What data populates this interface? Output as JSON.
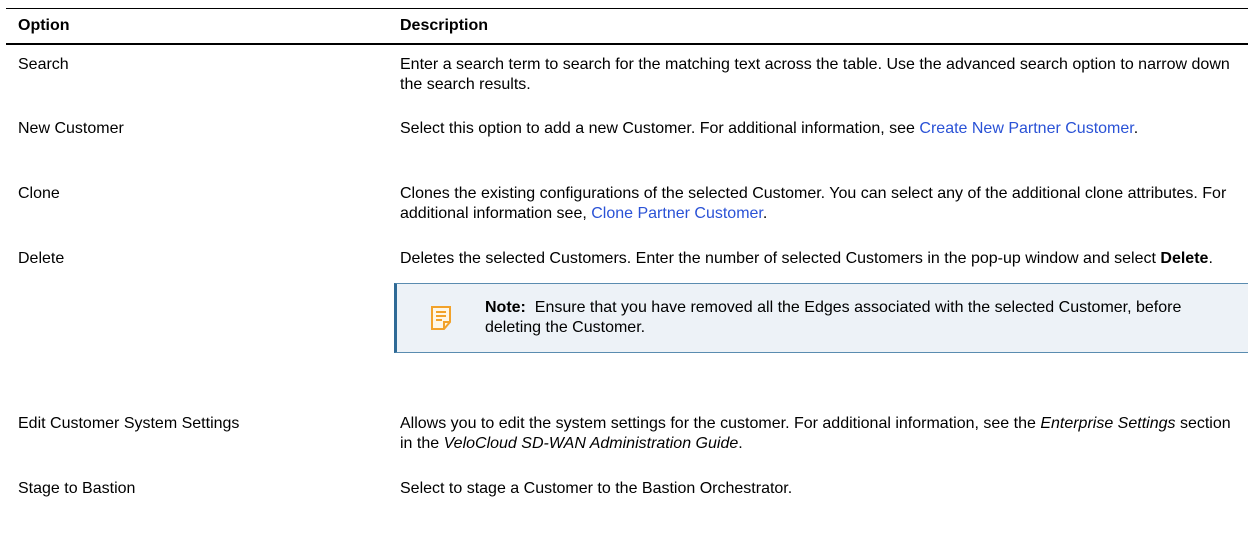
{
  "header": {
    "option": "Option",
    "description": "Description"
  },
  "rows": [
    {
      "option": "Search",
      "desc": "Enter a search term to search for the matching text across the table. Use the advanced search option to narrow down the search results."
    },
    {
      "option": "New Customer",
      "desc_before": "Select this option to add a new Customer. For additional information, see ",
      "link": "Create New Partner Customer",
      "desc_after": "."
    },
    {
      "option": "Clone",
      "desc_before": "Clones the existing configurations of the selected Customer. You can select any of the additional clone attributes. For additional information see, ",
      "link": "Clone Partner Customer",
      "desc_after": "."
    },
    {
      "option": "Delete",
      "desc_before": "Deletes the selected Customers. Enter the number of selected Customers in the pop-up window and select ",
      "bold": "Delete",
      "desc_after": ".",
      "note_label": "Note:",
      "note_text": "Ensure that you have removed all the Edges associated with the selected Customer, before deleting the Customer.",
      "note_icon": "note-icon",
      "note_icon_color": "#f2a22a"
    },
    {
      "option": "Edit Customer System Settings",
      "desc_1": "Allows you to edit the system settings for the customer. For additional information, see the ",
      "em_1": "Enterprise Settings",
      "desc_2": " section in the ",
      "em_2": "VeloCloud SD-WAN Administration Guide",
      "desc_3": "."
    },
    {
      "option": "Stage to Bastion",
      "desc": "Select to stage a Customer to the Bastion Orchestrator."
    }
  ]
}
